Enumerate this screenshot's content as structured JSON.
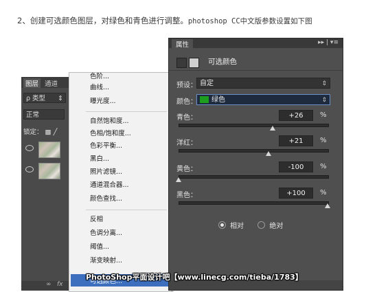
{
  "caption": {
    "text_cn": "2、创建可选颜色图层，对绿色和青色进行调整。",
    "text_en": "photoshop  CC中文版参数设置如下图"
  },
  "layers_panel": {
    "tab_layers": "图层",
    "tab_channels": "通道",
    "filter_kind": "ρ 类型",
    "blend_mode": "正常",
    "lock_label": "锁定：",
    "bottom_icons": [
      "link-icon",
      "fx-icon",
      "mask-icon",
      "adjustment-icon",
      "folder-icon",
      "new-layer-icon",
      "trash-icon"
    ]
  },
  "adjust_menu": {
    "group1": [
      "色阶...",
      "曲线...",
      "曝光度..."
    ],
    "group2": [
      "自然饱和度...",
      "色相/饱和度...",
      "色彩平衡...",
      "黑白...",
      "照片滤镜...",
      "通道混合器...",
      "颜色查找..."
    ],
    "group3": [
      "反相",
      "色调分离...",
      "阈值...",
      "渐变映射...",
      "可选颜色..."
    ],
    "highlighted": "可选颜色..."
  },
  "properties_panel": {
    "tab_title": "属性",
    "tab_menu": "▸▸ | ▾≡",
    "panel_title": "可选颜色",
    "preset_label": "预设：",
    "preset_value": "自定",
    "colors_label": "颜色：",
    "colors_value": "绿色",
    "sliders": [
      {
        "label": "青色：",
        "value": "+26",
        "unit": "%",
        "level_percent": 26
      },
      {
        "label": "洋红：",
        "value": "+21",
        "unit": "%",
        "level_percent": 21
      },
      {
        "label": "黄色：",
        "value": "-100",
        "unit": "%",
        "level_percent": -100
      },
      {
        "label": "黑色：",
        "value": "+100",
        "unit": "%",
        "level_percent": 100
      }
    ],
    "method_relative": "相对",
    "method_absolute": "绝对",
    "method_selected": "relative"
  },
  "watermark": "PhotoShop平面设计吧【www.linecg.com/tieba/1783】",
  "colors": {
    "panel_bg": "#4f4f4f",
    "menu_bg": "#f2f2f2",
    "menu_highlight": "#3d6fbe",
    "green_swatch": "#1e9e1e"
  }
}
